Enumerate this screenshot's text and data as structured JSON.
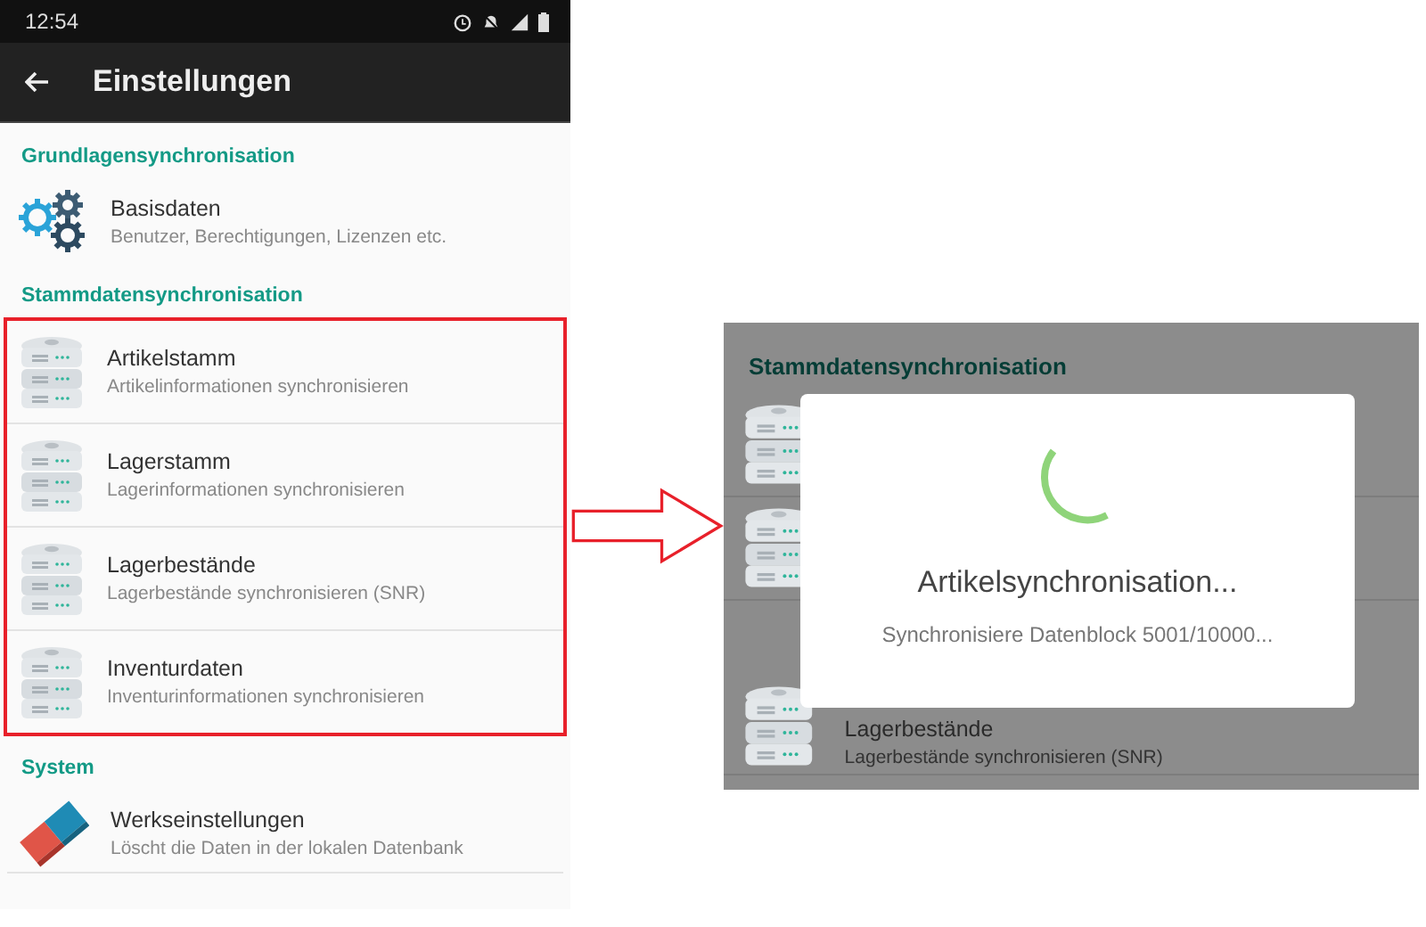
{
  "status_bar": {
    "time": "12:54"
  },
  "app_bar": {
    "title": "Einstellungen"
  },
  "sections": [
    {
      "title": "Grundlagensynchronisation",
      "highlighted": false,
      "items": [
        {
          "kind": "gears",
          "title": "Basisdaten",
          "subtitle": "Benutzer, Berechtigungen, Lizenzen etc."
        }
      ]
    },
    {
      "title": "Stammdatensynchronisation",
      "highlighted": true,
      "items": [
        {
          "kind": "database",
          "title": "Artikelstamm",
          "subtitle": "Artikelinformationen synchronisieren"
        },
        {
          "kind": "database",
          "title": "Lagerstamm",
          "subtitle": "Lagerinformationen synchronisieren"
        },
        {
          "kind": "database",
          "title": "Lagerbestände",
          "subtitle": "Lagerbestände synchronisieren (SNR)"
        },
        {
          "kind": "database",
          "title": "Inventurdaten",
          "subtitle": "Inventurinformationen synchronisieren"
        }
      ]
    },
    {
      "title": "System",
      "highlighted": false,
      "items": [
        {
          "kind": "eraser",
          "title": "Werkseinstellungen",
          "subtitle": "Löscht die Daten in der lokalen Datenbank"
        }
      ]
    }
  ],
  "preview": {
    "section_title": "Stammdatensynchronisation",
    "rows": [
      {
        "kind": "database"
      },
      {
        "kind": "database"
      },
      {
        "kind": "database",
        "title": "Lagerbestände",
        "subtitle": "Lagerbestände synchronisieren (SNR)"
      }
    ],
    "dialog": {
      "title": "Artikelsynchronisation...",
      "message": "Synchronisiere Datenblock 5001/10000..."
    }
  }
}
